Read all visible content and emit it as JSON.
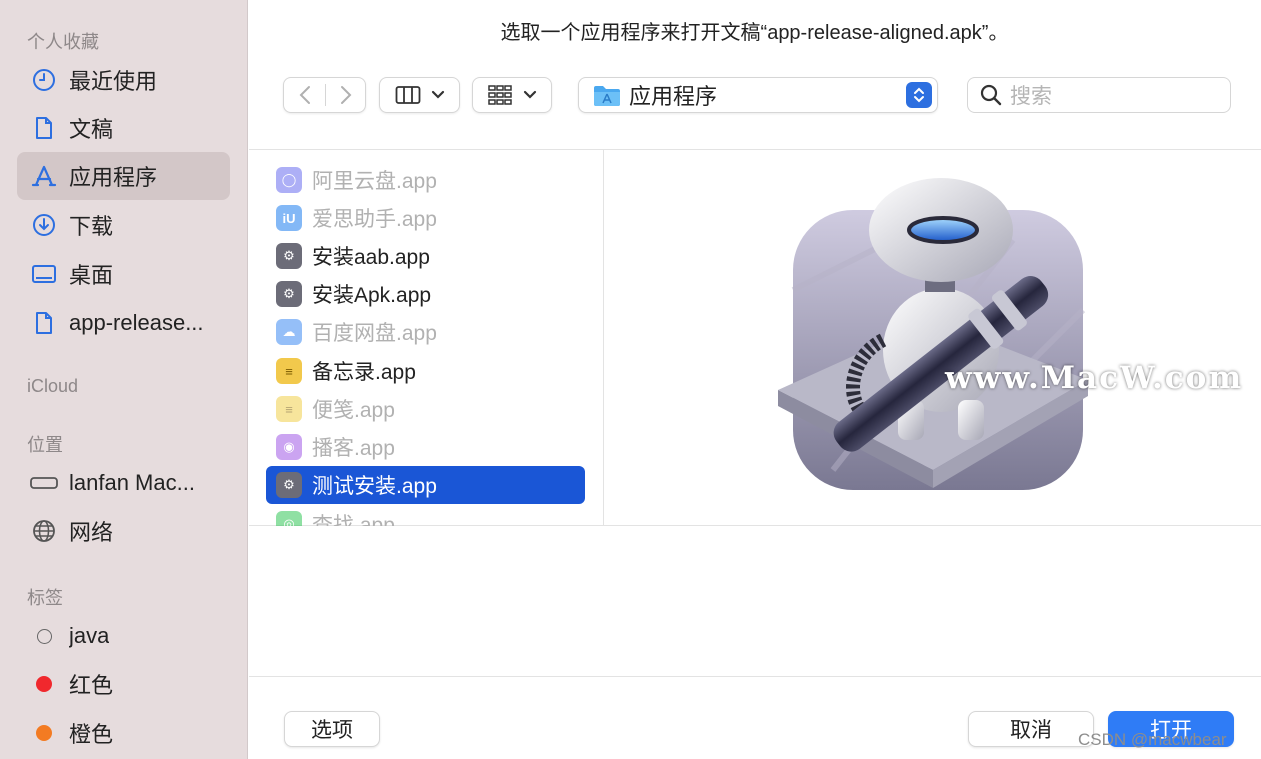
{
  "dialog": {
    "title": "选取一个应用程序来打开文稿“app-release-aligned.apk”。"
  },
  "sidebar": {
    "favorites_header": "个人收藏",
    "favorites": [
      {
        "label": "最近使用",
        "icon": "clock-icon"
      },
      {
        "label": "文稿",
        "icon": "document-icon"
      },
      {
        "label": "应用程序",
        "icon": "applications-icon",
        "selected": true
      },
      {
        "label": "下载",
        "icon": "download-icon"
      },
      {
        "label": "桌面",
        "icon": "desktop-icon"
      },
      {
        "label": "app-release...",
        "icon": "document-icon"
      }
    ],
    "icloud_header": "iCloud",
    "locations_header": "位置",
    "locations": [
      {
        "label": "lanfan Mac...",
        "icon": "drive-icon"
      },
      {
        "label": "网络",
        "icon": "globe-icon"
      }
    ],
    "tags_header": "标签",
    "tags": [
      {
        "label": "java",
        "color": "none"
      },
      {
        "label": "红色",
        "color": "#f0282d"
      },
      {
        "label": "橙色",
        "color": "#f37b22"
      }
    ]
  },
  "toolbar": {
    "back_icon": "chevron-left-icon",
    "forward_icon": "chevron-right-icon",
    "view_icon": "columns-view-icon",
    "group_icon": "grid-icon",
    "path_label": "应用程序",
    "search_placeholder": "搜索"
  },
  "file_list": [
    {
      "label": "阿里云盘.app",
      "dim": true,
      "icon_color": "#6b6ff0",
      "glyph": "◯"
    },
    {
      "label": "爱思助手.app",
      "dim": true,
      "icon_color": "#1f7ff0",
      "glyph": "iU"
    },
    {
      "label": "安装aab.app",
      "dim": false,
      "icon_color": "#6c6c78",
      "glyph": "⚙"
    },
    {
      "label": "安装Apk.app",
      "dim": false,
      "icon_color": "#6c6c78",
      "glyph": "⚙"
    },
    {
      "label": "百度网盘.app",
      "dim": true,
      "icon_color": "#3f8cf3",
      "glyph": "☁"
    },
    {
      "label": "备忘录.app",
      "dim": false,
      "icon_color": "#f2c94c",
      "glyph": "≡"
    },
    {
      "label": "便笺.app",
      "dim": true,
      "icon_color": "#f2d04c",
      "glyph": "≡"
    },
    {
      "label": "播客.app",
      "dim": true,
      "icon_color": "#a25ae6",
      "glyph": "◉"
    },
    {
      "label": "测试安装.app",
      "dim": false,
      "selected": true,
      "icon_color": "#6c6c78",
      "glyph": "⚙"
    },
    {
      "label": "查找.app",
      "dim": true,
      "icon_color": "#34c759",
      "glyph": "◎"
    }
  ],
  "preview": {
    "icon": "automator-robot-icon",
    "watermark": "www.MacW.com"
  },
  "footer": {
    "options_label": "选项",
    "cancel_label": "取消",
    "open_label": "打开"
  },
  "overlay_watermark": "CSDN @macwbear"
}
